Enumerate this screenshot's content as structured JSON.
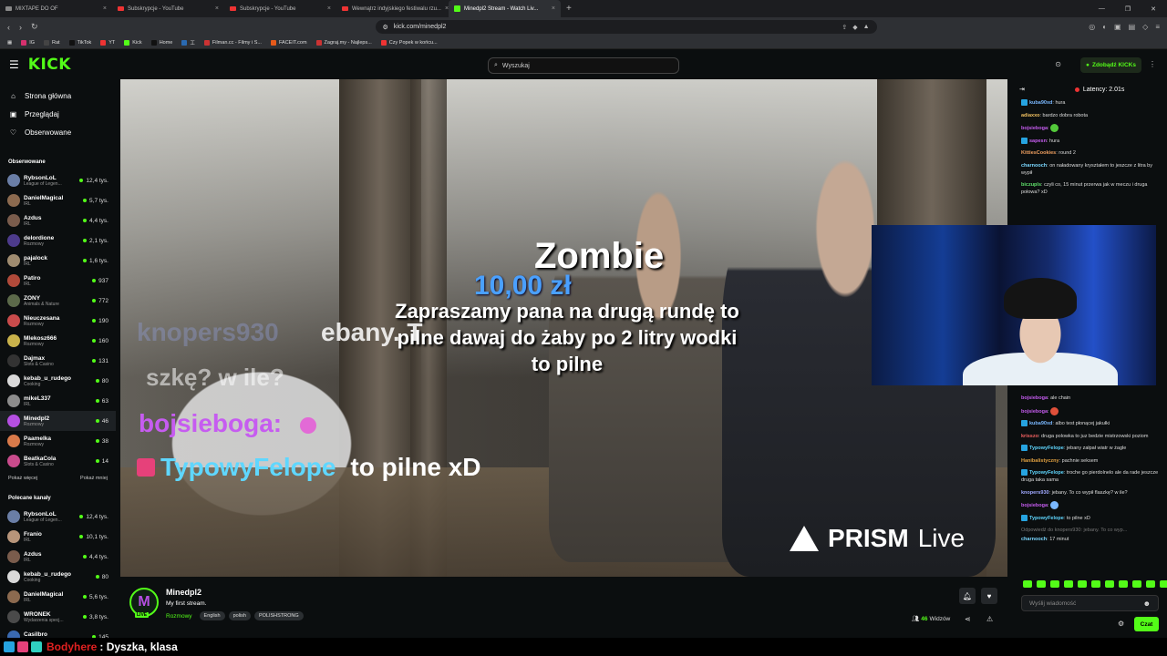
{
  "browser": {
    "tabs": [
      {
        "label": "MIXTAPE DO OF",
        "active": false
      },
      {
        "label": "Subskrypcje - YouTube",
        "active": false
      },
      {
        "label": "Subskrypcje - YouTube",
        "active": false
      },
      {
        "label": "Wewnątrz indyjskiego festiwalu rzu...",
        "active": false
      },
      {
        "label": "Minedpl2 Stream - Watch Liv...",
        "active": true
      }
    ],
    "url": "kick.com/minedpl2",
    "bookmarks": [
      "IG",
      "Rat",
      "TikTok",
      "YT",
      "Kick",
      "Home",
      "工",
      "Filman.cc - Filmy i S...",
      "FACEIT.com",
      "Zagraj.my - Najleps...",
      "Czy Popek w końcu..."
    ]
  },
  "kick": {
    "logo": "KICK",
    "search_placeholder": "Wyszukaj",
    "get_kicks": "Zdobądź KICKs"
  },
  "sidebar": {
    "nav": [
      {
        "label": "Strona główna",
        "icon": "home-icon"
      },
      {
        "label": "Przeglądaj",
        "icon": "browse-icon"
      },
      {
        "label": "Obserwowane",
        "icon": "heart-icon"
      }
    ],
    "followed_title": "Obserwowane",
    "followed": [
      {
        "name": "RybsonLoL",
        "cat": "League of Legen...",
        "viewers": "12,4 tys.",
        "color": "#6a7ea6"
      },
      {
        "name": "DanielMagical",
        "cat": "IRL",
        "viewers": "5,7 tys.",
        "color": "#8c6a4f"
      },
      {
        "name": "Azdus",
        "cat": "IRL",
        "viewers": "4,4 tys.",
        "color": "#7a5c4c"
      },
      {
        "name": "delordione",
        "cat": "Rozmowy",
        "viewers": "2,1 tys.",
        "color": "#4d3b8c"
      },
      {
        "name": "pajalock",
        "cat": "IRL",
        "viewers": "1,6 tys.",
        "color": "#a08c70"
      },
      {
        "name": "Patiro",
        "cat": "IRL",
        "viewers": "937",
        "color": "#b14a3a"
      },
      {
        "name": "ZONY",
        "cat": "Animals & Nature",
        "viewers": "772",
        "color": "#5c6a4a"
      },
      {
        "name": "Nieuczesana",
        "cat": "Rozmowy",
        "viewers": "190",
        "color": "#c94b4b"
      },
      {
        "name": "Mlekosz666",
        "cat": "Rozmowy",
        "viewers": "160",
        "color": "#c9b24b"
      },
      {
        "name": "Dajmax",
        "cat": "Slots & Casino",
        "viewers": "131",
        "color": "#333333"
      },
      {
        "name": "kebab_u_rudego",
        "cat": "Cooking",
        "viewers": "80",
        "color": "#d9d9d9"
      },
      {
        "name": "mikeL337",
        "cat": "IRL",
        "viewers": "63",
        "color": "#8c8c8c"
      },
      {
        "name": "Minedpl2",
        "cat": "Rozmowy",
        "viewers": "46",
        "color": "#b54fe2"
      },
      {
        "name": "Paamelka",
        "cat": "Rozmowy",
        "viewers": "38",
        "color": "#d97a4a"
      },
      {
        "name": "BeatkaCola",
        "cat": "Slots & Casino",
        "viewers": "14",
        "color": "#c94b8c"
      }
    ],
    "show_more": "Pokaż więcej",
    "show_less": "Pokaż mniej",
    "recommended_title": "Polecane kanały",
    "recommended": [
      {
        "name": "RybsonLoL",
        "cat": "League of Legen...",
        "viewers": "12,4 tys.",
        "color": "#6a7ea6"
      },
      {
        "name": "Franio",
        "cat": "IRL",
        "viewers": "10,1 tys.",
        "color": "#b8957a"
      },
      {
        "name": "Azdus",
        "cat": "IRL",
        "viewers": "4,4 tys.",
        "color": "#7a5c4c"
      },
      {
        "name": "kebab_u_rudego",
        "cat": "Cooking",
        "viewers": "80",
        "color": "#d9d9d9"
      },
      {
        "name": "DanielMagical",
        "cat": "IRL",
        "viewers": "5,6 tys.",
        "color": "#8c6a4f"
      },
      {
        "name": "WRONEK",
        "cat": "Wydarzenia specj...",
        "viewers": "3,8 tys.",
        "color": "#4a4a4a"
      },
      {
        "name": "Casilbro",
        "cat": "Slots & Casino",
        "viewers": "145",
        "color": "#3a6ab1"
      }
    ]
  },
  "video": {
    "donation_name": "Zombie",
    "donation_amount": "10,00 zł",
    "donation_message": "Zapraszamy pana na drugą rundę to pilne dawaj do żaby po 2 litry wodki to pilne",
    "overlay_user1": "knopers930",
    "overlay_text1": "ebany. T",
    "overlay_text2": "szkę? w ile?",
    "overlay_user2": "bojsieboga",
    "overlay_user3": "TypowyFelope",
    "overlay_text3": "to pilne xD",
    "prism_brand": "PRISM",
    "prism_live": "Live"
  },
  "stream": {
    "name": "Minedpl2",
    "title": "My first stream.",
    "category": "Rozmowy",
    "tags": [
      "English",
      "polish",
      "POLISHSTRONG"
    ],
    "viewers_count": "46",
    "viewers_label": "Widzów",
    "live_label": "LIVE"
  },
  "chat": {
    "latency": "Latency: 2.01s",
    "messages_top": [
      {
        "user": "kuba90xd",
        "text": "hura",
        "color": "#7ab8ff",
        "badge": true
      },
      {
        "user": "adiaxxo",
        "text": "bardzo dobra robota",
        "color": "#f0c060",
        "badge": false
      },
      {
        "user": "bojsieboga",
        "text": "",
        "color": "#c65cf0",
        "badge": false,
        "emote": "#53c93a"
      },
      {
        "user": "sapesn",
        "text": "hura",
        "color": "#c65cf0",
        "badge": true
      },
      {
        "user": "KittiesCookies",
        "text": "round 2",
        "color": "#f0a060",
        "badge": false
      },
      {
        "user": "charnooch",
        "text": "on naładowany kryształem to jeszcze z litra by wypił",
        "color": "#7ad7ff",
        "badge": false
      },
      {
        "user": "biczupls",
        "text": "czyli co, 15 minut przerwa jak w meczu i druga połowa? xD",
        "color": "#5fe06a",
        "badge": false
      }
    ],
    "messages_bottom": [
      {
        "user": "bojsieboga",
        "text": "ale chain",
        "color": "#c65cf0",
        "badge": false
      },
      {
        "user": "bojsieboga",
        "text": "",
        "color": "#c65cf0",
        "badge": false,
        "emote": "#e0503a"
      },
      {
        "user": "kuba90xd",
        "text": "albo test płonącej jakułki",
        "color": "#7ab8ff",
        "badge": true
      },
      {
        "user": "krisszo",
        "text": "druga polowka to juz bedzie mistrzowski poziom",
        "color": "#f06060",
        "badge": false
      },
      {
        "user": "TypowyFelope",
        "text": "jebany załpał wiatr w żagle",
        "color": "#5fd7ff",
        "badge": true
      },
      {
        "user": "Hanibalistyczny",
        "text": "pachnie seksem",
        "color": "#e0a040",
        "badge": false
      },
      {
        "user": "TypowyFelope",
        "text": "troche go pierdolnelo ale da rade jeszcze druga taka sama",
        "color": "#5fd7ff",
        "badge": true
      },
      {
        "user": "knopers930",
        "text": "jebany. To co wypił flaszkę? w ile?",
        "color": "#a0a8ff",
        "badge": false
      },
      {
        "user": "bojsieboga",
        "text": "",
        "color": "#c65cf0",
        "badge": false,
        "emote": "#7ab8ff"
      },
      {
        "user": "TypowyFelope",
        "text": "to pilne xD",
        "color": "#5fd7ff",
        "badge": true
      }
    ],
    "reply_note": "Odpowiedź do knopers930: jebany. To co wyp...",
    "last": {
      "user": "charnooch",
      "text": "17 minut",
      "color": "#7ad7ff"
    },
    "input_placeholder": "Wyślij wiadomość",
    "send_label": "Czat"
  },
  "bottom_overlay": {
    "user": "Bodyhere",
    "text": ": Dyszka, klasa"
  }
}
